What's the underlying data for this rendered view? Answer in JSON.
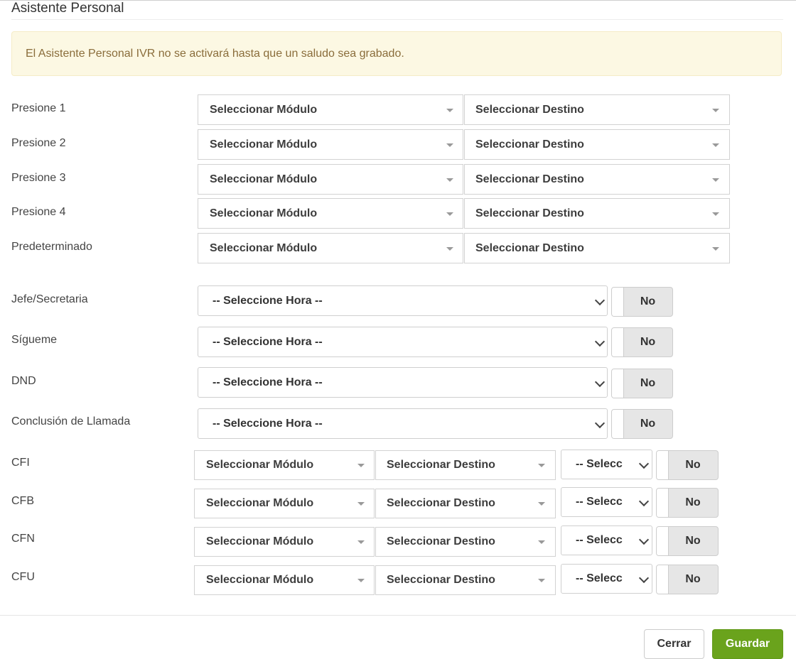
{
  "title": "Asistente Personal",
  "alert": "El Asistente Personal IVR no se activará hasta que un saludo sea grabado.",
  "press_rows": [
    {
      "label": "Presione 1",
      "module": "Seleccionar Módulo",
      "destination": "Seleccionar Destino"
    },
    {
      "label": "Presione 2",
      "module": "Seleccionar Módulo",
      "destination": "Seleccionar Destino"
    },
    {
      "label": "Presione 3",
      "module": "Seleccionar Módulo",
      "destination": "Seleccionar Destino"
    },
    {
      "label": "Presione 4",
      "module": "Seleccionar Módulo",
      "destination": "Seleccionar Destino"
    },
    {
      "label": "Predeterminado",
      "module": "Seleccionar Módulo",
      "destination": "Seleccionar Destino"
    }
  ],
  "time_rows": [
    {
      "label": "Jefe/Secretaria",
      "hour": "-- Seleccione Hora --",
      "toggle": "No"
    },
    {
      "label": "Sígueme",
      "hour": "-- Seleccione Hora --",
      "toggle": "No"
    },
    {
      "label": "DND",
      "hour": "-- Seleccione Hora --",
      "toggle": "No"
    },
    {
      "label": "Conclusión de Llamada",
      "hour": "-- Seleccione Hora --",
      "toggle": "No"
    }
  ],
  "cf_rows": [
    {
      "label": "CFI",
      "module": "Seleccionar Módulo",
      "destination": "Seleccionar Destino",
      "hour": "-- Selecc",
      "toggle": "No"
    },
    {
      "label": "CFB",
      "module": "Seleccionar Módulo",
      "destination": "Seleccionar Destino",
      "hour": "-- Selecc",
      "toggle": "No"
    },
    {
      "label": "CFN",
      "module": "Seleccionar Módulo",
      "destination": "Seleccionar Destino",
      "hour": "-- Selecc",
      "toggle": "No"
    },
    {
      "label": "CFU",
      "module": "Seleccionar Módulo",
      "destination": "Seleccionar Destino",
      "hour": "-- Selecc",
      "toggle": "No"
    }
  ],
  "buttons": {
    "close": "Cerrar",
    "save": "Guardar"
  },
  "colors": {
    "alert_bg": "#fcf8e3",
    "alert_text": "#8a6d3b",
    "save_bg": "#6aa31c",
    "toggle_bg": "#e6e6e6"
  }
}
